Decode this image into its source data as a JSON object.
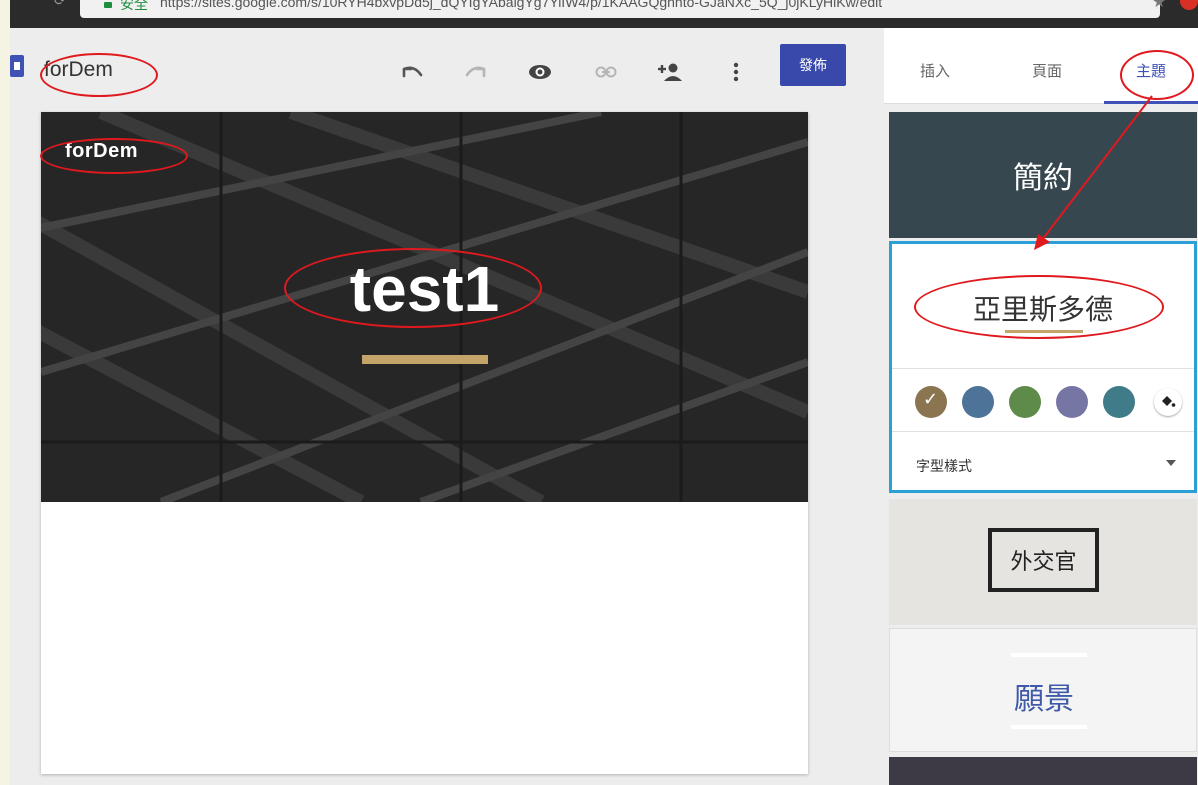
{
  "browser": {
    "secure_label": "安全",
    "url": "https://sites.google.com/s/10RYH4bxvpDd5j_dQYIgYAbalgYg7YiIW4/p/1KAAGQgnnto-GJaNXc_5Q_j0jKLyHiKw/edit"
  },
  "editor": {
    "site_name": "forDem",
    "publish_label": "發佈",
    "icons": [
      "undo-icon",
      "redo-icon",
      "preview-eye-icon",
      "link-icon",
      "add-person-icon",
      "more-vert-icon"
    ]
  },
  "preview": {
    "site_name": "forDem",
    "title": "test1",
    "accent_color": "#c5a46a"
  },
  "panel": {
    "tabs": [
      {
        "label": "插入",
        "active": false
      },
      {
        "label": "頁面",
        "active": false
      },
      {
        "label": "主題",
        "active": true
      }
    ],
    "themes": {
      "simple": {
        "label": "簡約"
      },
      "aristotle": {
        "label": "亞里斯多德",
        "swatches": [
          "#8b7450",
          "#4e7399",
          "#5e8a4a",
          "#7676a4",
          "#3f7b89"
        ],
        "selected_swatch": 0,
        "font_style_label": "字型樣式"
      },
      "diplomat": {
        "label": "外交官"
      },
      "vision": {
        "label": "願景"
      }
    }
  },
  "colors": {
    "brand": "#3f51b5",
    "annotation": "#e0191e",
    "selection": "#2aa0d6"
  }
}
